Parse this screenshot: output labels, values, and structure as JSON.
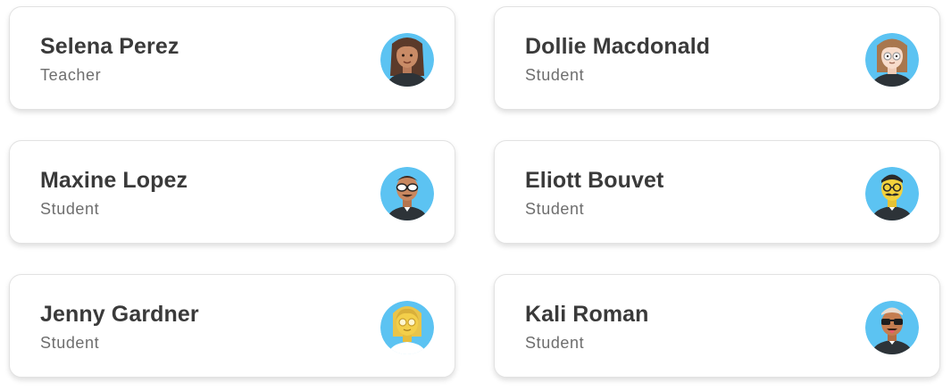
{
  "colors": {
    "avatar_background": "#5cc3f2"
  },
  "cards": [
    {
      "name": "Selena Perez",
      "role": "Teacher",
      "avatar": "woman-brown-hair-avatar-icon"
    },
    {
      "name": "Dollie Macdonald",
      "role": "Student",
      "avatar": "woman-glasses-avatar-icon"
    },
    {
      "name": "Maxine Lopez",
      "role": "Student",
      "avatar": "man-sunglasses-avatar-icon"
    },
    {
      "name": "Eliott Bouvet",
      "role": "Student",
      "avatar": "man-mustache-glasses-avatar-icon"
    },
    {
      "name": "Jenny Gardner",
      "role": "Student",
      "avatar": "woman-blonde-glasses-avatar-icon"
    },
    {
      "name": "Kali Roman",
      "role": "Student",
      "avatar": "man-sunglasses-tongue-avatar-icon"
    }
  ]
}
